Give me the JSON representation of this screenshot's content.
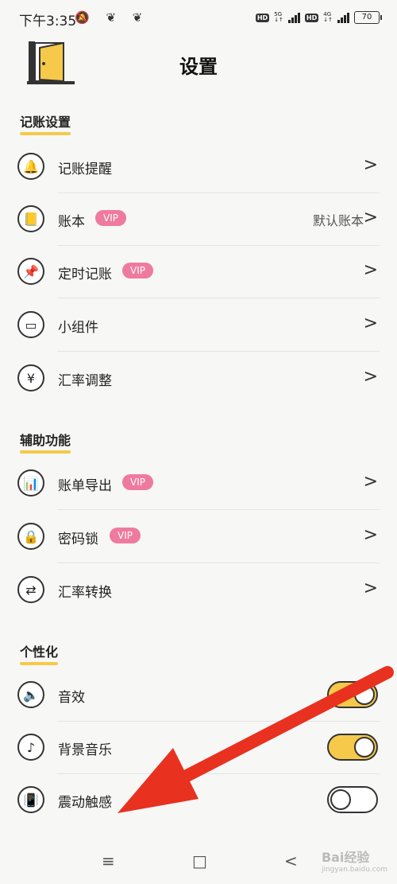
{
  "status_bar": {
    "time": "下午3:35",
    "hd1": "HD",
    "net1": "5G",
    "hd2": "HD",
    "net2": "4G",
    "battery": "70"
  },
  "header": {
    "title": "设置"
  },
  "sections": {
    "bookkeeping": "记账设置",
    "assist": "辅助功能",
    "personal": "个性化"
  },
  "rows": {
    "reminder": {
      "label": "记账提醒",
      "icon": "bell-icon"
    },
    "ledger": {
      "label": "账本",
      "badge": "VIP",
      "value": "默认账本",
      "icon": "notebook-icon"
    },
    "scheduled": {
      "label": "定时记账",
      "badge": "VIP",
      "icon": "pin-icon"
    },
    "widget": {
      "label": "小组件",
      "icon": "widget-icon"
    },
    "rate_adjust": {
      "label": "汇率调整",
      "icon": "yen-icon"
    },
    "export": {
      "label": "账单导出",
      "badge": "VIP",
      "icon": "export-icon"
    },
    "lock": {
      "label": "密码锁",
      "badge": "VIP",
      "icon": "lock-icon"
    },
    "rate_convert": {
      "label": "汇率转换",
      "icon": "swap-icon"
    },
    "sound": {
      "label": "音效",
      "toggle": true,
      "icon": "speaker-icon"
    },
    "music": {
      "label": "背景音乐",
      "toggle": true,
      "icon": "music-note-icon"
    },
    "vibrate": {
      "label": "震动触感",
      "toggle": false,
      "icon": "vibrate-icon"
    }
  },
  "colors": {
    "accent": "#f6c94a",
    "vip": "#ef7aa0",
    "annotation_arrow": "#e8311f"
  },
  "nav": {
    "menu": "≡",
    "home": "□",
    "back": "<"
  },
  "watermark": {
    "line1": "Bai",
    "line2": "经验",
    "line3": "jingyan.baidu.com"
  }
}
